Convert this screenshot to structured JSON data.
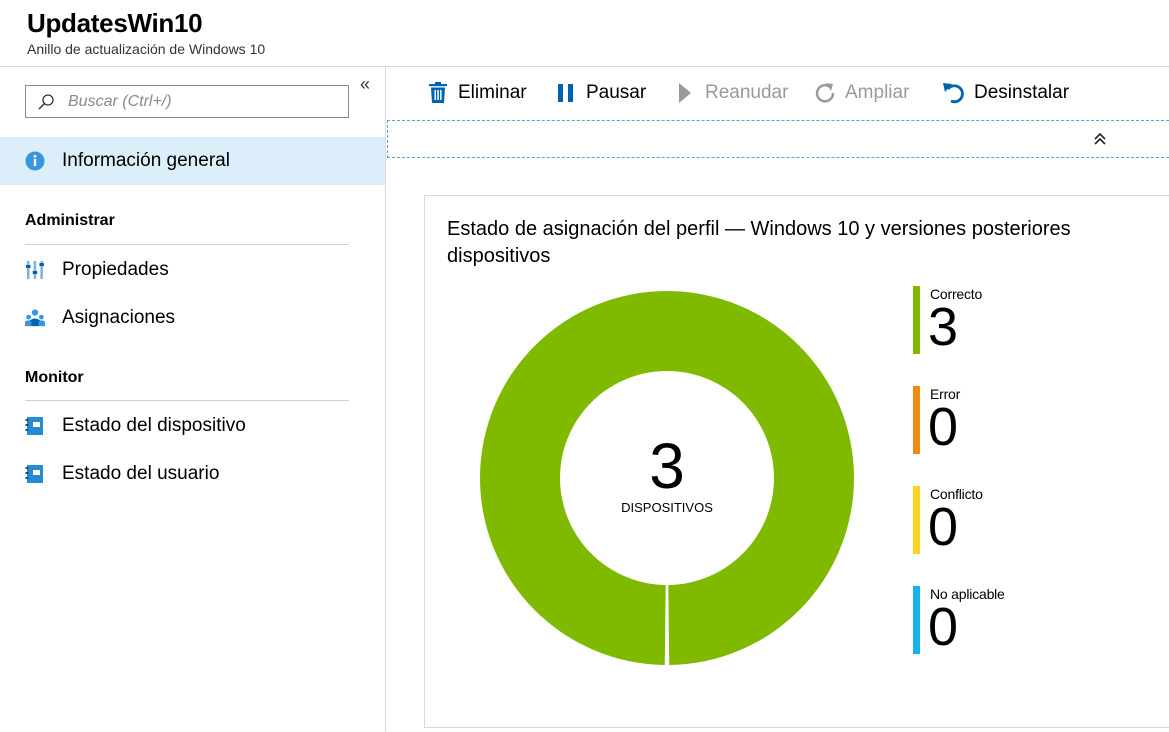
{
  "header": {
    "title": "UpdatesWin10",
    "subtitle": "Anillo de actualización de Windows 10"
  },
  "sidebar": {
    "collapse_glyph": "«",
    "search": {
      "placeholder": "Buscar (Ctrl+/)",
      "value": ""
    },
    "overview": {
      "label": "Información general",
      "icon": "info-icon",
      "active": true
    },
    "sections": [
      {
        "heading": "Administrar",
        "items": [
          {
            "label": "Propiedades",
            "icon": "properties-icon"
          },
          {
            "label": "Asignaciones",
            "icon": "assignments-icon"
          }
        ]
      },
      {
        "heading": "Monitor",
        "items": [
          {
            "label": "Estado del dispositivo",
            "icon": "device-status-icon"
          },
          {
            "label": "Estado del usuario",
            "icon": "user-status-icon"
          }
        ]
      }
    ]
  },
  "toolbar": {
    "buttons": [
      {
        "label": "Eliminar",
        "icon": "trash-icon",
        "enabled": true
      },
      {
        "label": "Pausar",
        "icon": "pause-icon",
        "enabled": true
      },
      {
        "label": "Reanudar",
        "icon": "play-icon",
        "enabled": false
      },
      {
        "label": "Ampliar",
        "icon": "refresh-icon",
        "enabled": false
      },
      {
        "label": "Desinstalar",
        "icon": "undo-icon",
        "enabled": true
      }
    ]
  },
  "colors": {
    "accent": "#0063b1",
    "correct": "#7fba00",
    "error": "#f38a12",
    "conflict": "#f8d21b",
    "not_applicable": "#18b4e9",
    "disabled": "#9a9a9a"
  },
  "card": {
    "title": "Estado de asignación del perfil — Windows 10 y versiones posteriores dispositivos",
    "center_value": "3",
    "center_label": "DISPOSITIVOS"
  },
  "chart_data": {
    "type": "pie",
    "title": "Estado de asignación del perfil — Windows 10 y versiones posteriores dispositivos",
    "categories": [
      "Correcto",
      "Error",
      "Conflicto",
      "No aplicable"
    ],
    "values": [
      3,
      0,
      0,
      0
    ],
    "colors": [
      "#7fba00",
      "#f38a12",
      "#f8d21b",
      "#18b4e9"
    ],
    "total": 3,
    "total_label": "DISPOSITIVOS",
    "legend_placement": "right"
  }
}
